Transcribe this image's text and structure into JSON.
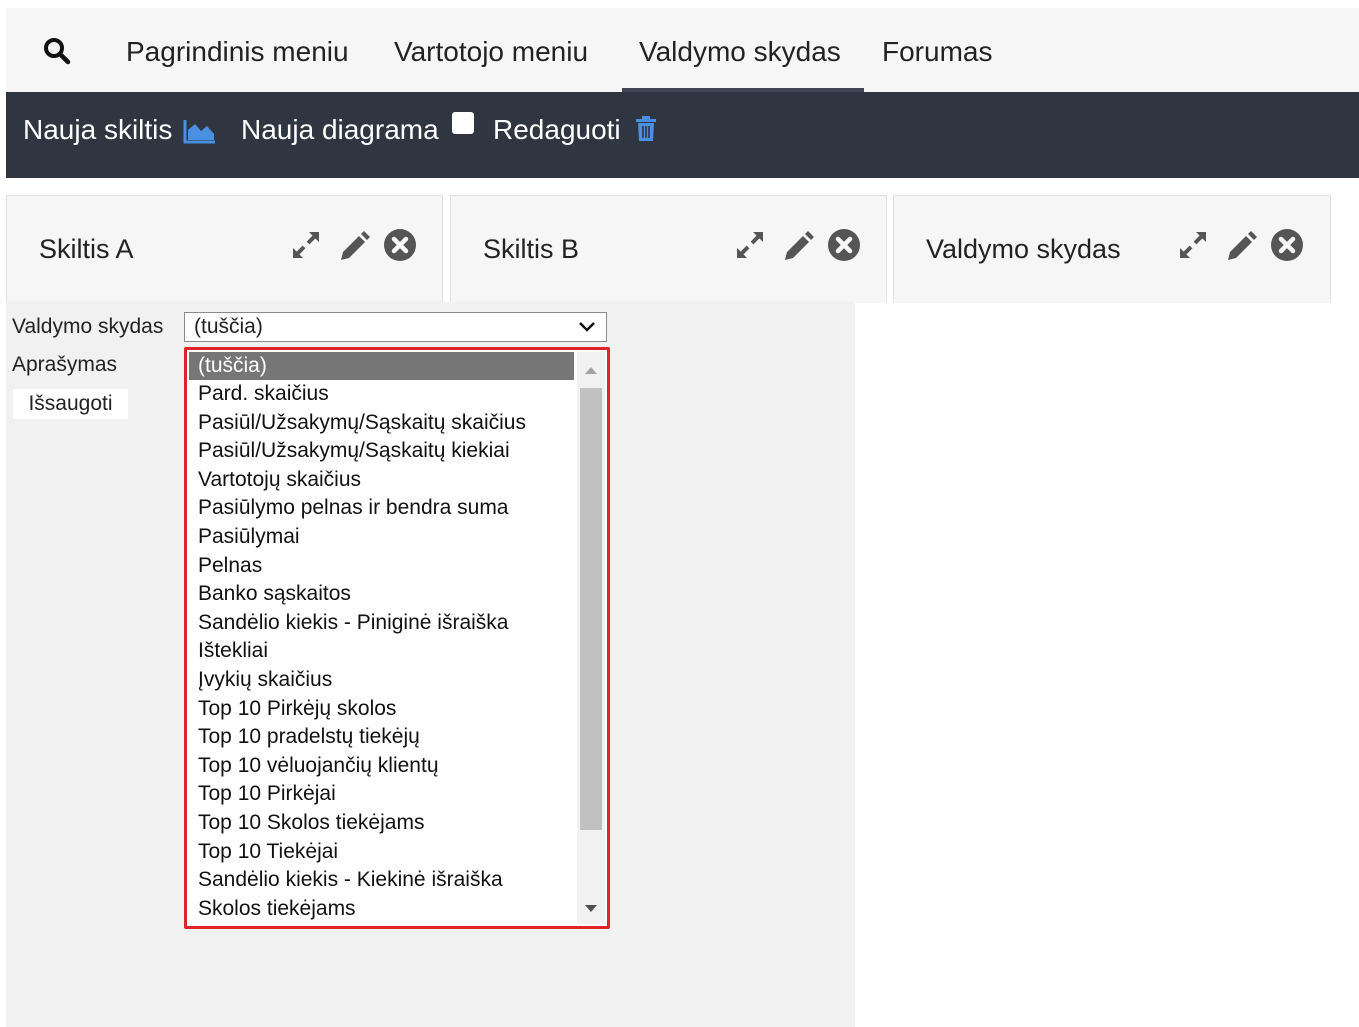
{
  "topnav": {
    "tabs": [
      {
        "label": "Pagrindinis meniu"
      },
      {
        "label": "Vartotojo meniu"
      },
      {
        "label": "Valdymo skydas",
        "active": true
      },
      {
        "label": "Forumas"
      }
    ]
  },
  "toolbar": {
    "new_column_label": "Nauja skiltis",
    "new_chart_label": "Nauja diagrama",
    "edit_label": "Redaguoti",
    "accent": "#4a90e2"
  },
  "cards": [
    {
      "title": "Skiltis A"
    },
    {
      "title": "Skiltis B"
    },
    {
      "title": "Valdymo skydas"
    }
  ],
  "form": {
    "dashboard_label": "Valdymo skydas",
    "description_label": "Aprašymas",
    "selected_value": "(tuščia)",
    "save_label": "Išsaugoti"
  },
  "listbox": {
    "options": [
      "(tuščia)",
      "Pard. skaičius",
      "Pasiūl/Užsakymų/Sąskaitų skaičius",
      "Pasiūl/Užsakymų/Sąskaitų kiekiai",
      "Vartotojų skaičius",
      "Pasiūlymo pelnas ir bendra suma",
      "Pasiūlymai",
      "Pelnas",
      "Banko sąskaitos",
      "Sandėlio kiekis - Piniginė išraiška",
      "Ištekliai",
      "Įvykių skaičius",
      "Top 10 Pirkėjų skolos",
      "Top 10 pradelstų tiekėjų",
      "Top 10 vėluojančių klientų",
      "Top 10 Pirkėjai",
      "Top 10 Skolos tiekėjams",
      "Top 10 Tiekėjai",
      "Sandėlio kiekis - Kiekinė išraiška",
      "Skolos tiekėjams"
    ],
    "highlight_color": "#e0222b"
  }
}
